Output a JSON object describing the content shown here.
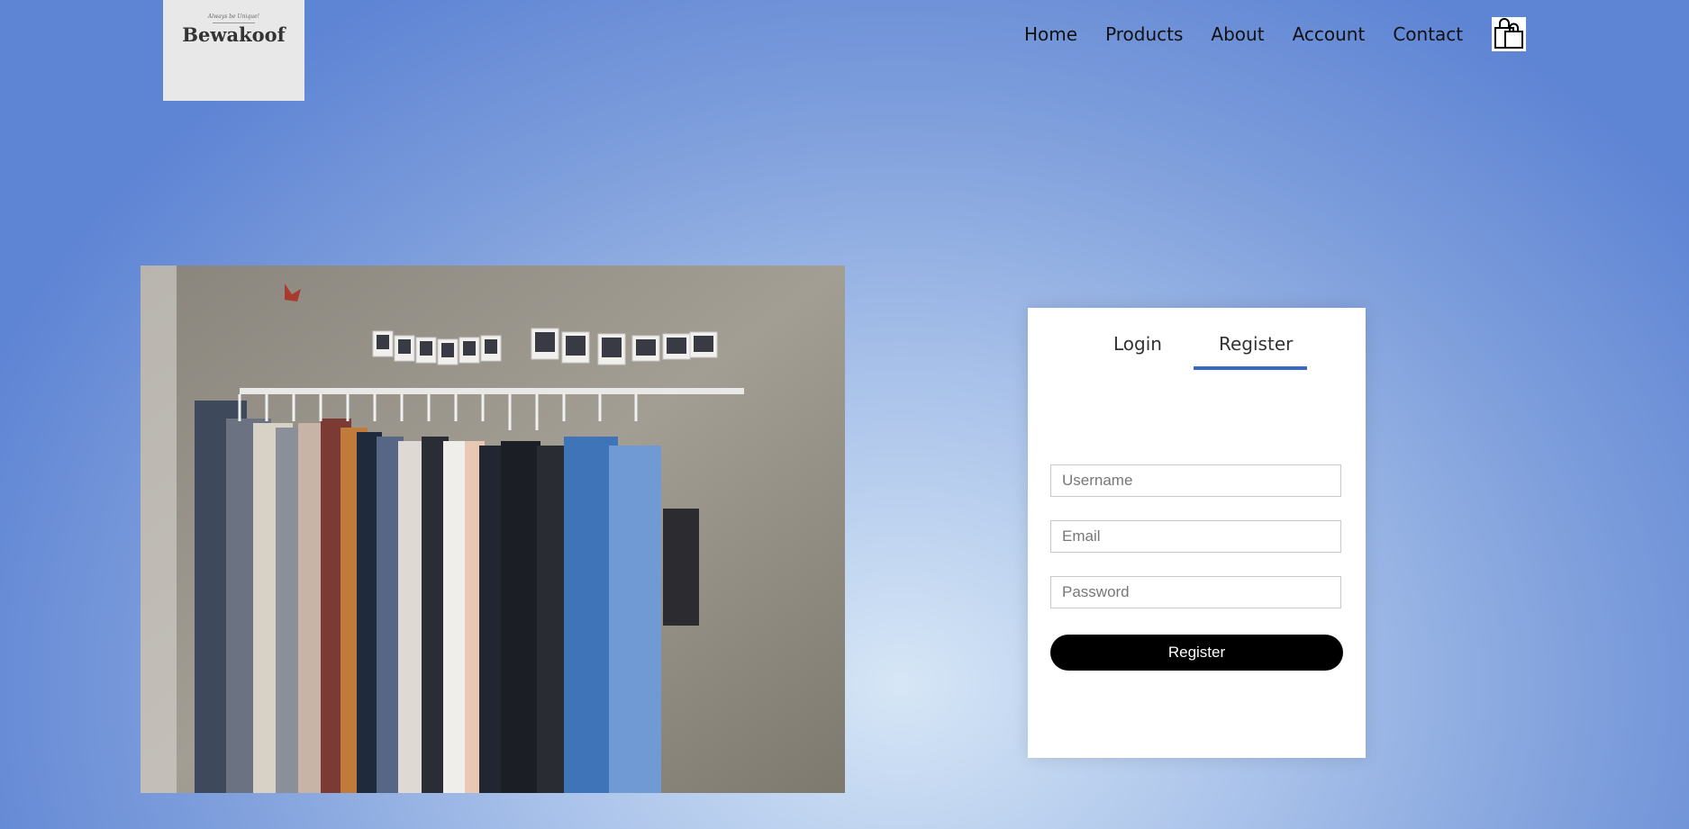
{
  "brand": {
    "tagline": "Always be Unique!",
    "name": "Bewakoof"
  },
  "nav": {
    "items": [
      "Home",
      "Products",
      "About",
      "Account",
      "Contact"
    ]
  },
  "icons": {
    "cart": "shopping-bag-icon"
  },
  "colors": {
    "accent": "#3b68c6",
    "button": "#000000",
    "card": "#ffffff"
  },
  "form": {
    "tabs": {
      "login": "Login",
      "register": "Register"
    },
    "active_tab": "Register",
    "username_placeholder": "Username",
    "email_placeholder": "Email",
    "password_placeholder": "Password",
    "submit_label": "Register"
  }
}
